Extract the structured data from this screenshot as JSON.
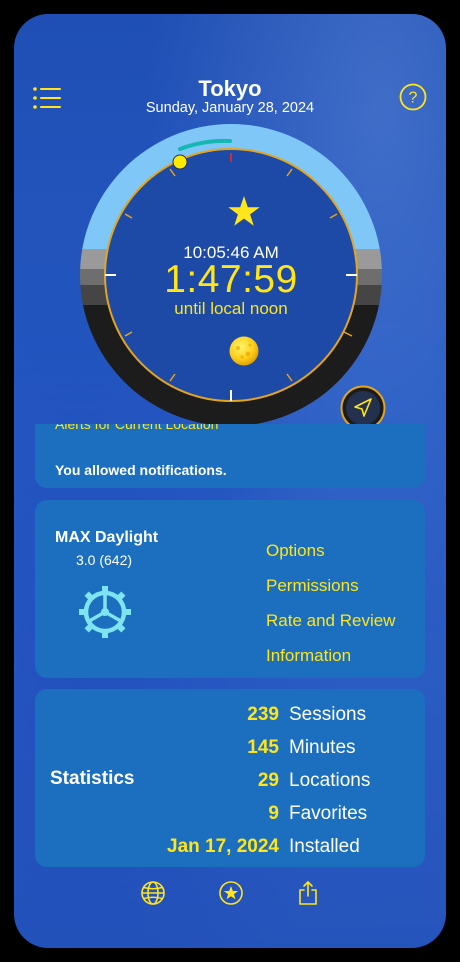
{
  "header": {
    "city": "Tokyo",
    "date": "Sunday, January 28, 2024"
  },
  "dial": {
    "local_time": "10:05:46 AM",
    "countdown": "1:47:59",
    "countdown_label": "until local noon"
  },
  "notifications_card": {
    "clipped_label": "Alerts for Current Location",
    "status": "You allowed notifications."
  },
  "app_card": {
    "name": "MAX Daylight",
    "version": "3.0 (642)",
    "links": [
      "Options",
      "Permissions",
      "Rate and Review",
      "Information"
    ]
  },
  "statistics": {
    "label": "Statistics",
    "rows": [
      {
        "value": "239",
        "label": "Sessions"
      },
      {
        "value": "145",
        "label": "Minutes"
      },
      {
        "value": "29",
        "label": "Locations"
      },
      {
        "value": "9",
        "label": "Favorites"
      },
      {
        "value": "Jan 17, 2024",
        "label": "Installed"
      }
    ]
  },
  "colors": {
    "accent_yellow": "#ffe51a",
    "card_blue": "#1b6fbe",
    "daylight_arc": "#7fc7f7",
    "night_arc": "#1a1a1a",
    "gear_cyan": "#7fe4f0"
  },
  "icons": [
    "menu-icon",
    "help-icon",
    "star-icon",
    "sun-icon",
    "location-arrow-icon",
    "gear-icon",
    "globe-icon",
    "star-circle-icon",
    "share-icon"
  ]
}
